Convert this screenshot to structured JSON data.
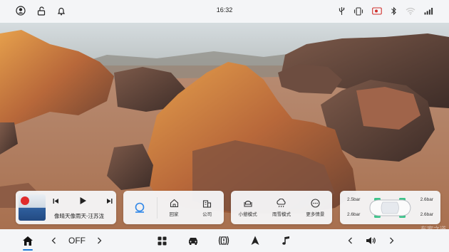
{
  "status_bar": {
    "time": "16:32",
    "left_icons": [
      "user-icon",
      "unlock-icon",
      "bell-icon"
    ],
    "right_icons": [
      "usb-icon",
      "vibrate-icon",
      "camera-record-icon",
      "bluetooth-icon",
      "wifi-icon",
      "signal-icon"
    ]
  },
  "media": {
    "song_title": "像晴天像雨天-汪苏泷",
    "controls": [
      "previous-icon",
      "play-icon",
      "next-icon"
    ]
  },
  "quick_nav": {
    "items": [
      {
        "icon": "location-icon",
        "label": ""
      },
      {
        "icon": "home-icon",
        "label": "回家"
      },
      {
        "icon": "office-icon",
        "label": "公司"
      }
    ]
  },
  "scenes": {
    "items": [
      {
        "icon": "nap-mode-icon",
        "label": "小憩模式"
      },
      {
        "icon": "rain-snow-icon",
        "label": "雨雪模式"
      },
      {
        "icon": "more-icon",
        "label": "更多情景"
      }
    ]
  },
  "tire_pressure": {
    "front_left": "2.5bar",
    "front_right": "2.6bar",
    "rear_left": "2.6bar",
    "rear_right": "2.6bar"
  },
  "dock": {
    "climate_state": "OFF",
    "icons": [
      "home-icon",
      "chevron-left-icon",
      "chevron-right-icon",
      "apps-icon",
      "car-icon",
      "tire-pressure-icon",
      "navigation-icon",
      "music-icon",
      "chevron-left-icon",
      "volume-icon",
      "chevron-right-icon"
    ]
  },
  "watermark": "车家之道"
}
